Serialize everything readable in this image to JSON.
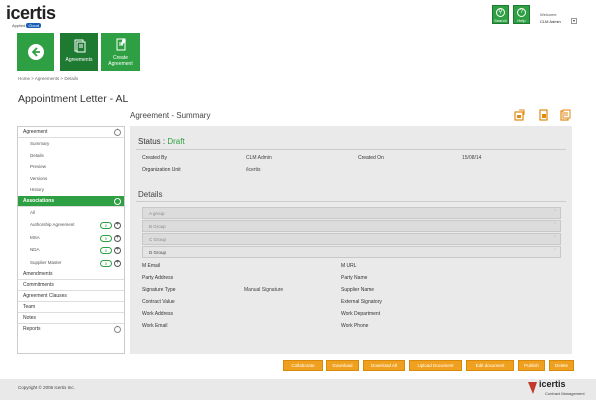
{
  "brand": {
    "name": "icertis",
    "applied_prefix": "Applied",
    "cloud": "Cloud"
  },
  "topbar": {
    "search_label": "Search",
    "help_label": "Help",
    "welcome": "Welcome",
    "user": "CLM Admin"
  },
  "tiles": {
    "agreements": "Agreements",
    "create_1": "Create",
    "create_2": "Agreement"
  },
  "breadcrumb": [
    "Home",
    "Agreements",
    "Details"
  ],
  "page_title": "Appointment Letter - AL",
  "section_title": "Agreement - Summary",
  "sidebar": {
    "agreement_header": "Agreement",
    "agreement_items": [
      "Summary",
      "Details",
      "Preview",
      "Versions",
      "History"
    ],
    "associations_header": "Associations",
    "associations": [
      {
        "label": "All",
        "count": ""
      },
      {
        "label": "Authorship Agreement",
        "count": "0"
      },
      {
        "label": "MSA",
        "count": "0"
      },
      {
        "label": "NDA",
        "count": "0"
      },
      {
        "label": "Supplier Master",
        "count": "0"
      }
    ],
    "more": [
      "Amendments",
      "Commitments",
      "Agreement Clauses",
      "Team",
      "Notes",
      "Reports"
    ]
  },
  "status": {
    "label": "Status :",
    "value": "Draft"
  },
  "summary": {
    "created_by_label": "Created By",
    "created_by": "CLM Admin",
    "created_on_label": "Created On",
    "created_on": "15/08/14",
    "org_unit_label": "Organization Unit",
    "org_unit": "/icertis"
  },
  "details_title": "Details",
  "groups": [
    "A group",
    "B Group",
    "C Group",
    "D Group"
  ],
  "fields_left": [
    {
      "label": "M Email",
      "value": ""
    },
    {
      "label": "Party Address",
      "value": ""
    },
    {
      "label": "Signature Type",
      "value": "Manual Signature"
    },
    {
      "label": "Contract Value",
      "value": ""
    },
    {
      "label": "Work Address",
      "value": ""
    },
    {
      "label": "Work Email",
      "value": ""
    }
  ],
  "fields_right": [
    "M URL",
    "Party Name",
    "Supplier Name",
    "External Signatory",
    "Work Department",
    "Work Phone"
  ],
  "actions": [
    "Collaborate",
    "Download",
    "Download All",
    "Upload Document",
    "Edit document",
    "Publish",
    "Delete"
  ],
  "footer": {
    "copyright": "Copyright © 2006 Icertis Inc.",
    "brand": "icertis",
    "product": "Contract Management"
  },
  "colors": {
    "green": "#2ea043",
    "orange": "#f0a01f"
  }
}
